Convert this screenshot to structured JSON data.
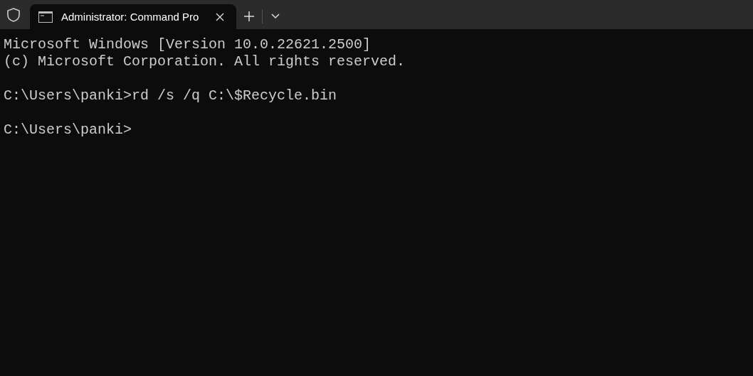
{
  "tabs": [
    {
      "title": "Administrator: Command Pro",
      "selected": true
    }
  ],
  "terminal": {
    "blocks": [
      [
        "Microsoft Windows [Version 10.0.22621.2500]",
        "(c) Microsoft Corporation. All rights reserved."
      ],
      [
        "C:\\Users\\panki>rd /s /q C:\\$Recycle.bin"
      ],
      [
        "C:\\Users\\panki>"
      ]
    ]
  }
}
